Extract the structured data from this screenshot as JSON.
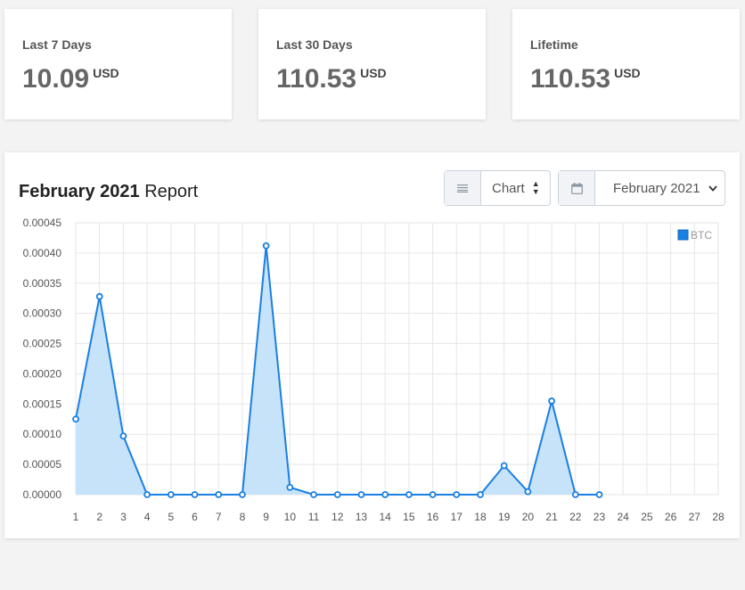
{
  "stats": [
    {
      "label": "Last 7 Days",
      "value": "10.09",
      "unit": "USD"
    },
    {
      "label": "Last 30 Days",
      "value": "110.53",
      "unit": "USD"
    },
    {
      "label": "Lifetime",
      "value": "110.53",
      "unit": "USD"
    }
  ],
  "report": {
    "title_bold": "February 2021",
    "title_rest": "Report",
    "view_select": "Chart",
    "month_select": "February 2021"
  },
  "chart_data": {
    "type": "line",
    "x": [
      1,
      2,
      3,
      4,
      5,
      6,
      7,
      8,
      9,
      10,
      11,
      12,
      13,
      14,
      15,
      16,
      17,
      18,
      19,
      20,
      21,
      22,
      23
    ],
    "categories": [
      "1",
      "2",
      "3",
      "4",
      "5",
      "6",
      "7",
      "8",
      "9",
      "10",
      "11",
      "12",
      "13",
      "14",
      "15",
      "16",
      "17",
      "18",
      "19",
      "20",
      "21",
      "22",
      "23",
      "24",
      "25",
      "26",
      "27",
      "28"
    ],
    "series": [
      {
        "name": "BTC",
        "values": [
          0.000125,
          0.000328,
          9.7e-05,
          0,
          0,
          0,
          0,
          0,
          0.000412,
          1.2e-05,
          0,
          0,
          0,
          0,
          0,
          0,
          0,
          0,
          4.8e-05,
          5e-06,
          0.000155,
          0,
          0
        ]
      }
    ],
    "y_ticks": [
      "0.00000",
      "0.00005",
      "0.00010",
      "0.00015",
      "0.00020",
      "0.00025",
      "0.00030",
      "0.00035",
      "0.00040",
      "0.00045"
    ],
    "ylim": [
      0,
      0.00045
    ],
    "grid": true,
    "legend": "top-right",
    "colors": {
      "line": "#1a7fe3",
      "fill": "#c6e3f9"
    }
  }
}
